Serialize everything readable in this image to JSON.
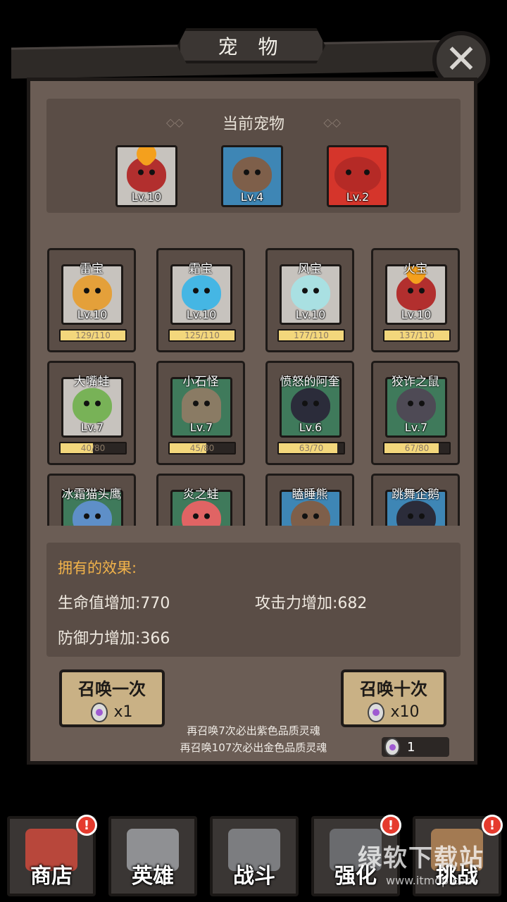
{
  "header": {
    "title": "宠 物"
  },
  "current": {
    "title": "当前宠物",
    "slots": [
      {
        "level": "Lv.10",
        "color": "gray"
      },
      {
        "level": "Lv.4",
        "color": "blue"
      },
      {
        "level": "Lv.2",
        "color": "red"
      }
    ]
  },
  "pets": [
    {
      "name": "雷宝",
      "level": "Lv.10",
      "progress": "129/110",
      "fill": 1.0
    },
    {
      "name": "霜宝",
      "level": "Lv.10",
      "progress": "125/110",
      "fill": 1.0
    },
    {
      "name": "风宝",
      "level": "Lv.10",
      "progress": "177/110",
      "fill": 1.0
    },
    {
      "name": "火宝",
      "level": "Lv.10",
      "progress": "137/110",
      "fill": 1.0
    },
    {
      "name": "大嘴蛙",
      "level": "Lv.7",
      "progress": "40/80",
      "fill": 0.5
    },
    {
      "name": "小石怪",
      "level": "Lv.7",
      "progress": "45/80",
      "fill": 0.56
    },
    {
      "name": "愤怒的阿奎",
      "level": "Lv.6",
      "progress": "63/70",
      "fill": 0.9
    },
    {
      "name": "狡诈之鼠",
      "level": "Lv.7",
      "progress": "67/80",
      "fill": 0.84
    },
    {
      "name": "冰霜猫头鹰",
      "level": "",
      "progress": "",
      "fill": 0
    },
    {
      "name": "炎之蛙",
      "level": "",
      "progress": "",
      "fill": 0
    },
    {
      "name": "瞌睡熊",
      "level": "",
      "progress": "",
      "fill": 0
    },
    {
      "name": "跳舞企鹅",
      "level": "",
      "progress": "",
      "fill": 0
    }
  ],
  "effects": {
    "title": "拥有的效果:",
    "hp": "生命值增加:770",
    "atk": "攻击力增加:682",
    "def": "防御力增加:366"
  },
  "summon": {
    "once_label": "召唤一次",
    "once_cost": "x1",
    "ten_label": "召唤十次",
    "ten_cost": "x10",
    "hint1": "再召唤7次必出紫色品质灵魂",
    "hint2": "再召唤107次必出金色品质灵魂",
    "egg_count": "1"
  },
  "nav": {
    "shop": "商店",
    "hero": "英雄",
    "battle": "战斗",
    "upgrade": "强化",
    "challenge": "挑战",
    "badge": "!"
  },
  "watermark": {
    "main": "绿软下载站",
    "sub": "www.itmop.com"
  },
  "colors": {
    "panel": "#6b5d55",
    "inner": "#5a4d46",
    "gold": "#f2b34a",
    "button": "#c9b185"
  }
}
